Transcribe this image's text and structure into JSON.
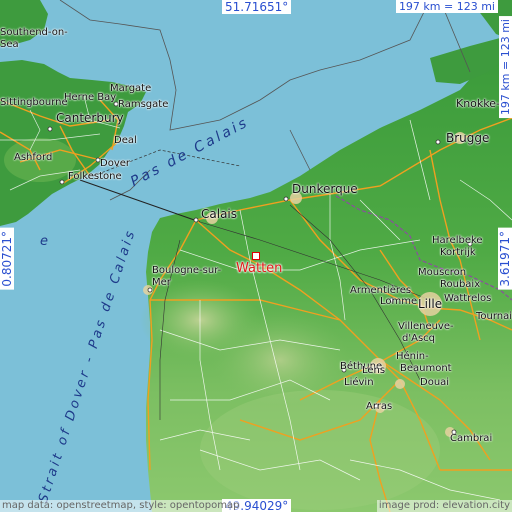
{
  "coords": {
    "top": "51.71651°",
    "bottom": "49.94029°",
    "left": "0.80721°",
    "right": "3.61971°"
  },
  "scale": {
    "horizontal": "197 km = 123 mi",
    "vertical": "197 km = 123 mi"
  },
  "highlight": {
    "name": "Watten"
  },
  "cities": {
    "southend": "Southend-on-",
    "sea_frag": "Sea",
    "margate": "Margate",
    "herne_bay": "Herne Bay",
    "sittingbourne": "Sittingbourne",
    "ramsgate": "Ramsgate",
    "canterbury": "Canterbury",
    "deal": "Deal",
    "ashford": "Ashford",
    "dover": "Dover",
    "folkestone": "Folkestone",
    "knokke": "Knokke-Heist",
    "brugge": "Brugge",
    "dunkerque": "Dunkerque",
    "calais": "Calais",
    "harelbeke": "Harelbeke",
    "kortrijk": "Kortrijk",
    "boulogne": "Boulogne-sur-",
    "boulogne2": "Mer",
    "mouscron": "Mouscron",
    "roubaix": "Roubaix",
    "armentieres": "Armentières",
    "wattrelos": "Wattrelos",
    "lomme": "Lomme",
    "lille": "Lille",
    "tournai": "Tournai",
    "villeneuve": "Villeneuve-",
    "villeneuve2": "d'Ascq",
    "bethune": "Béthune",
    "henin": "Hénin-",
    "beaumont": "Beaumont",
    "lens": "Lens",
    "lievin": "Liévin",
    "douai": "Douai",
    "arras": "Arras",
    "cambrai": "Cambrai"
  },
  "seas": {
    "pas_de_calais": "Pas de Calais",
    "strait_of_dover": "Strait of Dover - Pas de Calais",
    "e_fragment": "e"
  },
  "attribution": {
    "left": "map data: openstreetmap, style: opentopomap",
    "right": "image prod: elevation.city"
  },
  "colors": {
    "sea": "#7cc0d8",
    "land_low": "#3e9b3e",
    "land_mid": "#6db85a",
    "land_high": "#a6c98a",
    "road_major": "#f0a020",
    "coord_text": "#2a4fd0",
    "marker": "#e01a1a"
  }
}
